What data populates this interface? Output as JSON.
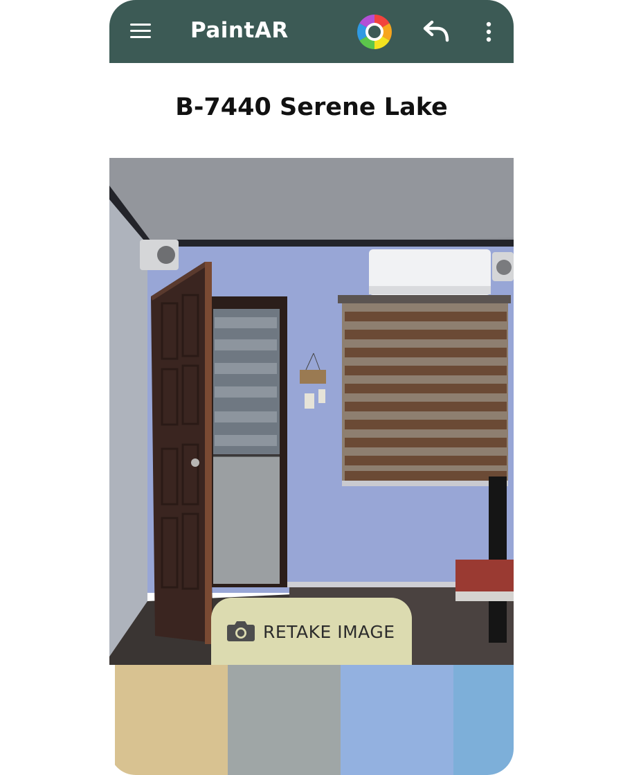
{
  "app": {
    "title": "PaintAR"
  },
  "header": {
    "menu_icon": "hamburger-menu-icon",
    "color_wheel_icon": "color-wheel-icon",
    "undo_icon": "undo-arrow-icon",
    "more_icon": "more-vertical-icon",
    "bar_color": "#3c5a55"
  },
  "color": {
    "name": "B-7440 Serene Lake",
    "wall_tint": "#98a6d6"
  },
  "photo": {
    "description_icon": "room-photo"
  },
  "actions": {
    "retake_label": "RETAKE IMAGE",
    "retake_icon": "camera-icon",
    "retake_bg": "#dcdbb0"
  },
  "palette": {
    "swatches": [
      {
        "color": "#d8c291"
      },
      {
        "color": "#9fa6a6"
      },
      {
        "color": "#93b1e0"
      },
      {
        "color": "#7dafd9"
      }
    ]
  }
}
